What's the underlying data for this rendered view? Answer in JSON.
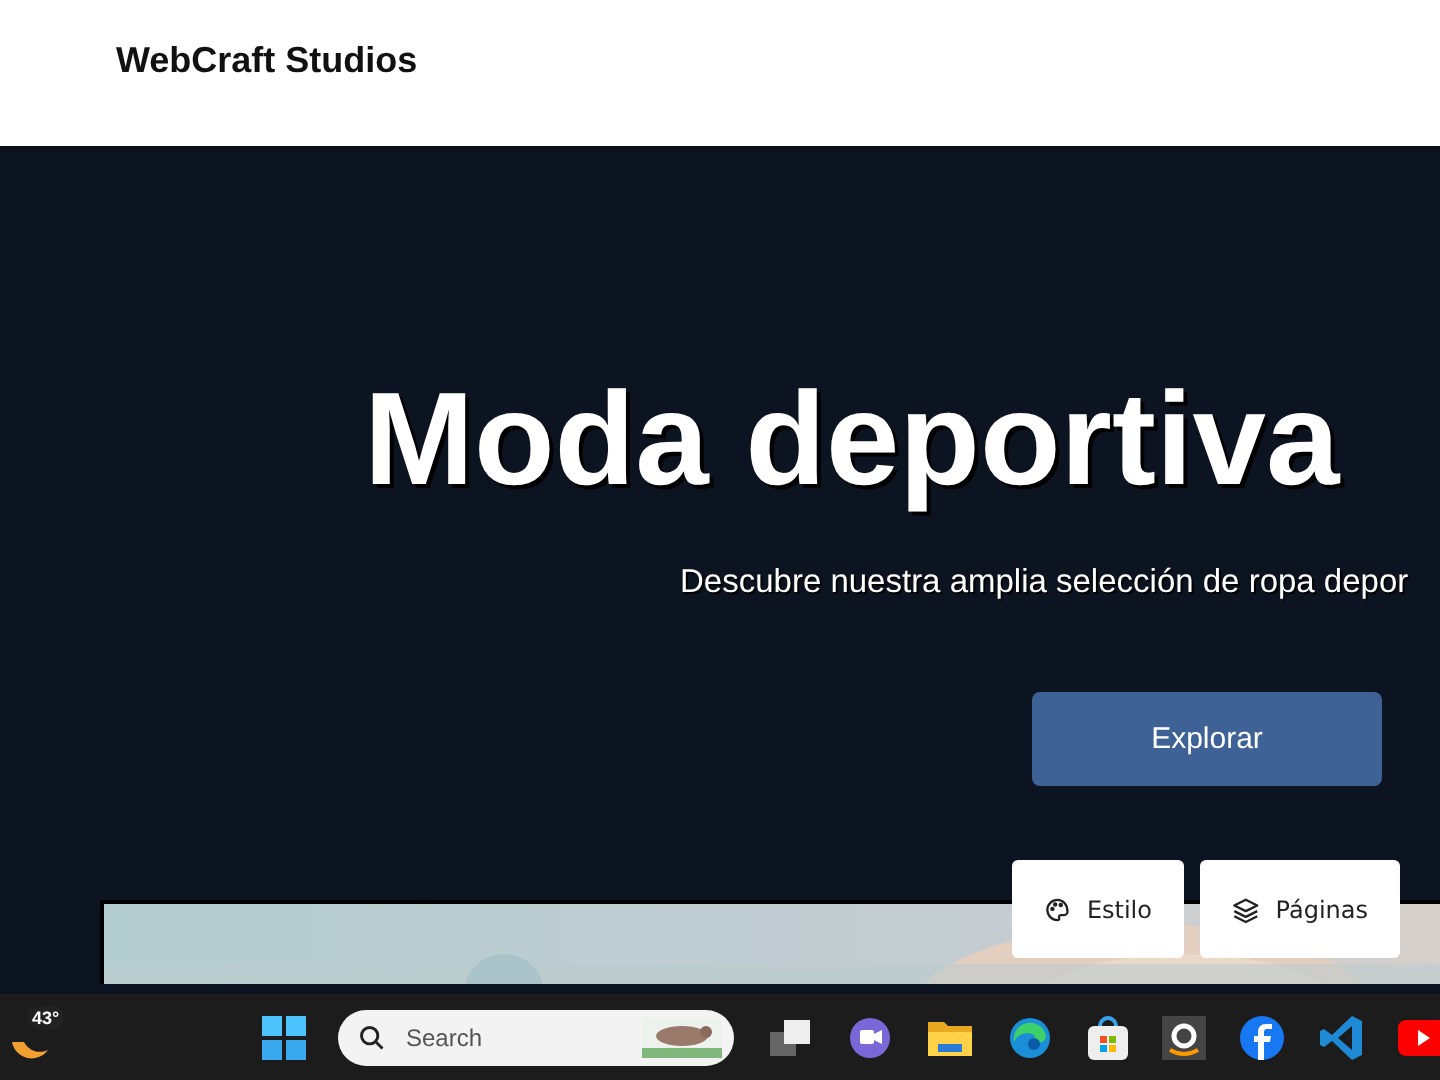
{
  "header": {
    "brand": "WebCraft Studios"
  },
  "hero": {
    "title": "Moda deportiva",
    "subtitle": "Descubre nuestra amplia selección de ropa depor",
    "cta": "Explorar"
  },
  "floating_buttons": [
    {
      "kind": "palette",
      "label": "Estilo"
    },
    {
      "kind": "layers",
      "label": "Páginas"
    }
  ],
  "taskbar": {
    "weather": "43°",
    "search": {
      "placeholder": "Search"
    },
    "apps": [
      {
        "kind": "taskview"
      },
      {
        "kind": "chat"
      },
      {
        "kind": "folder"
      },
      {
        "kind": "edge"
      },
      {
        "kind": "store"
      },
      {
        "kind": "amazon"
      },
      {
        "kind": "facebook"
      },
      {
        "kind": "vscode"
      },
      {
        "kind": "youtube"
      }
    ]
  }
}
